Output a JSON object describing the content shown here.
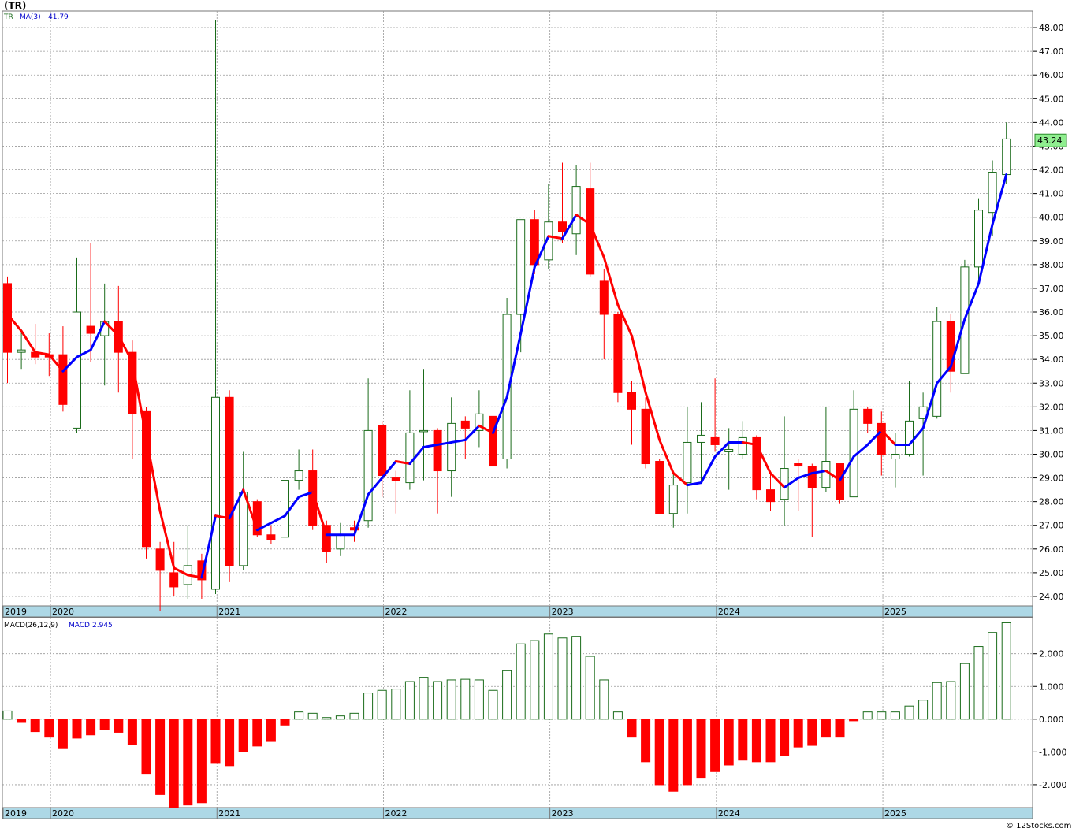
{
  "header": {
    "symbol": "(TR)"
  },
  "watermark": "© 12Stocks.com",
  "colors": {
    "up": "#1a6b1a",
    "down": "#ff0000",
    "ma_up": "#0000ff",
    "ma_down": "#ff0000",
    "axis_bar": "#add8e6",
    "last_box": "#90ee90"
  },
  "chart_data": [
    {
      "type": "candlestick",
      "legend": {
        "symbol": "TR",
        "ma_label": "MA(3)",
        "ma_value": "41.79"
      },
      "last_price_label": "43.24",
      "ylim": [
        23.6,
        48.7
      ],
      "y_ticks": [
        "24.00",
        "25.00",
        "26.00",
        "27.00",
        "28.00",
        "29.00",
        "30.00",
        "31.00",
        "32.00",
        "33.00",
        "34.00",
        "35.00",
        "36.00",
        "37.00",
        "38.00",
        "39.00",
        "40.00",
        "41.00",
        "42.00",
        "43.00",
        "44.00",
        "45.00",
        "46.00",
        "47.00",
        "48.00"
      ],
      "x_ticks": [
        {
          "label": "2019",
          "index": -0.4
        },
        {
          "label": "2020",
          "index": 3.1
        },
        {
          "label": "2021",
          "index": 15.1
        },
        {
          "label": "2022",
          "index": 27.1
        },
        {
          "label": "2023",
          "index": 39.1
        },
        {
          "label": "2024",
          "index": 51.1
        },
        {
          "label": "2025",
          "index": 63.1
        }
      ],
      "candles": [
        {
          "o": 37.2,
          "h": 37.5,
          "l": 33.0,
          "c": 34.3
        },
        {
          "o": 34.3,
          "h": 35.3,
          "l": 33.6,
          "c": 34.4
        },
        {
          "o": 34.3,
          "h": 35.5,
          "l": 33.8,
          "c": 34.1
        },
        {
          "o": 34.2,
          "h": 35.1,
          "l": 33.3,
          "c": 34.1
        },
        {
          "o": 34.2,
          "h": 35.4,
          "l": 31.8,
          "c": 32.1
        },
        {
          "o": 31.1,
          "h": 38.3,
          "l": 30.9,
          "c": 36.0
        },
        {
          "o": 35.4,
          "h": 38.9,
          "l": 33.9,
          "c": 35.1
        },
        {
          "o": 35.0,
          "h": 37.2,
          "l": 32.9,
          "c": 35.6
        },
        {
          "o": 35.6,
          "h": 37.1,
          "l": 32.6,
          "c": 34.3
        },
        {
          "o": 34.3,
          "h": 34.8,
          "l": 29.8,
          "c": 31.7
        },
        {
          "o": 31.8,
          "h": 32.0,
          "l": 25.6,
          "c": 26.1
        },
        {
          "o": 26.0,
          "h": 26.3,
          "l": 23.4,
          "c": 25.1
        },
        {
          "o": 25.0,
          "h": 26.3,
          "l": 24.0,
          "c": 24.4
        },
        {
          "o": 24.5,
          "h": 27.0,
          "l": 23.9,
          "c": 25.3
        },
        {
          "o": 25.5,
          "h": 25.8,
          "l": 23.9,
          "c": 24.7
        },
        {
          "o": 24.3,
          "h": 48.3,
          "l": 24.1,
          "c": 32.4
        },
        {
          "o": 32.4,
          "h": 32.7,
          "l": 24.6,
          "c": 25.3
        },
        {
          "o": 25.3,
          "h": 30.1,
          "l": 25.1,
          "c": 28.4
        },
        {
          "o": 28.0,
          "h": 28.1,
          "l": 26.5,
          "c": 26.6
        },
        {
          "o": 26.6,
          "h": 27.0,
          "l": 26.2,
          "c": 26.4
        },
        {
          "o": 26.5,
          "h": 30.9,
          "l": 26.4,
          "c": 28.9
        },
        {
          "o": 28.9,
          "h": 30.2,
          "l": 28.5,
          "c": 29.3
        },
        {
          "o": 29.3,
          "h": 30.2,
          "l": 26.8,
          "c": 27.0
        },
        {
          "o": 27.0,
          "h": 27.2,
          "l": 25.4,
          "c": 25.9
        },
        {
          "o": 26.0,
          "h": 27.1,
          "l": 25.7,
          "c": 26.6
        },
        {
          "o": 26.9,
          "h": 27.2,
          "l": 26.3,
          "c": 26.8
        },
        {
          "o": 27.2,
          "h": 33.2,
          "l": 26.9,
          "c": 31.0
        },
        {
          "o": 31.2,
          "h": 31.4,
          "l": 28.2,
          "c": 29.1
        },
        {
          "o": 29.0,
          "h": 29.3,
          "l": 27.5,
          "c": 28.9
        },
        {
          "o": 28.8,
          "h": 32.7,
          "l": 28.5,
          "c": 30.9
        },
        {
          "o": 31.0,
          "h": 33.6,
          "l": 28.9,
          "c": 31.0
        },
        {
          "o": 31.0,
          "h": 31.1,
          "l": 27.5,
          "c": 29.3
        },
        {
          "o": 29.3,
          "h": 32.4,
          "l": 28.2,
          "c": 31.3
        },
        {
          "o": 31.4,
          "h": 31.6,
          "l": 29.8,
          "c": 31.1
        },
        {
          "o": 31.0,
          "h": 32.7,
          "l": 30.3,
          "c": 31.7
        },
        {
          "o": 31.6,
          "h": 31.8,
          "l": 29.4,
          "c": 29.5
        },
        {
          "o": 29.8,
          "h": 36.6,
          "l": 29.4,
          "c": 35.9
        },
        {
          "o": 35.9,
          "h": 39.9,
          "l": 34.3,
          "c": 39.9
        },
        {
          "o": 39.9,
          "h": 40.3,
          "l": 37.6,
          "c": 38.0
        },
        {
          "o": 38.2,
          "h": 41.4,
          "l": 37.8,
          "c": 39.8
        },
        {
          "o": 39.8,
          "h": 42.3,
          "l": 38.9,
          "c": 39.4
        },
        {
          "o": 39.3,
          "h": 42.2,
          "l": 38.4,
          "c": 41.3
        },
        {
          "o": 41.2,
          "h": 42.3,
          "l": 37.5,
          "c": 37.6
        },
        {
          "o": 37.3,
          "h": 37.8,
          "l": 34.0,
          "c": 35.9
        },
        {
          "o": 35.9,
          "h": 36.0,
          "l": 32.2,
          "c": 32.6
        },
        {
          "o": 32.6,
          "h": 33.1,
          "l": 30.4,
          "c": 31.9
        },
        {
          "o": 31.9,
          "h": 32.4,
          "l": 29.4,
          "c": 29.6
        },
        {
          "o": 29.7,
          "h": 29.8,
          "l": 27.6,
          "c": 27.5
        },
        {
          "o": 27.5,
          "h": 29.2,
          "l": 26.9,
          "c": 28.7
        },
        {
          "o": 28.8,
          "h": 32.0,
          "l": 27.5,
          "c": 30.5
        },
        {
          "o": 30.5,
          "h": 32.2,
          "l": 28.8,
          "c": 30.8
        },
        {
          "o": 30.7,
          "h": 33.2,
          "l": 30.1,
          "c": 30.4
        },
        {
          "o": 30.1,
          "h": 31.1,
          "l": 28.5,
          "c": 30.2
        },
        {
          "o": 30.0,
          "h": 31.4,
          "l": 29.8,
          "c": 30.7
        },
        {
          "o": 30.7,
          "h": 30.8,
          "l": 28.1,
          "c": 28.5
        },
        {
          "o": 28.5,
          "h": 29.2,
          "l": 27.6,
          "c": 28.0
        },
        {
          "o": 28.1,
          "h": 31.6,
          "l": 27.0,
          "c": 29.4
        },
        {
          "o": 29.6,
          "h": 29.8,
          "l": 27.6,
          "c": 29.5
        },
        {
          "o": 29.5,
          "h": 29.6,
          "l": 26.5,
          "c": 28.6
        },
        {
          "o": 28.6,
          "h": 32.0,
          "l": 28.4,
          "c": 29.7
        },
        {
          "o": 29.6,
          "h": 29.6,
          "l": 27.9,
          "c": 28.1
        },
        {
          "o": 28.2,
          "h": 32.7,
          "l": 28.2,
          "c": 31.9
        },
        {
          "o": 31.9,
          "h": 32.0,
          "l": 30.9,
          "c": 31.3
        },
        {
          "o": 31.3,
          "h": 31.8,
          "l": 29.1,
          "c": 30.0
        },
        {
          "o": 29.8,
          "h": 30.9,
          "l": 28.6,
          "c": 30.0
        },
        {
          "o": 30.0,
          "h": 33.1,
          "l": 29.9,
          "c": 31.4
        },
        {
          "o": 31.5,
          "h": 32.6,
          "l": 29.1,
          "c": 32.0
        },
        {
          "o": 31.6,
          "h": 36.2,
          "l": 31.5,
          "c": 35.6
        },
        {
          "o": 35.6,
          "h": 35.9,
          "l": 32.6,
          "c": 33.5
        },
        {
          "o": 33.4,
          "h": 38.2,
          "l": 33.4,
          "c": 37.9
        },
        {
          "o": 37.9,
          "h": 40.8,
          "l": 37.2,
          "c": 40.3
        },
        {
          "o": 40.2,
          "h": 42.4,
          "l": 39.2,
          "c": 41.9
        },
        {
          "o": 41.8,
          "h": 44.0,
          "l": 41.4,
          "c": 43.3
        }
      ],
      "ma3": [
        35.9,
        35.2,
        34.3,
        34.2,
        33.5,
        34.1,
        34.4,
        35.6,
        35.0,
        33.9,
        30.7,
        27.6,
        25.2,
        24.9,
        24.8,
        27.4,
        27.3,
        28.5,
        26.8,
        27.1,
        27.4,
        28.2,
        28.4,
        26.6,
        26.6,
        26.6,
        28.3,
        29.0,
        29.7,
        29.6,
        30.3,
        30.4,
        30.5,
        30.6,
        31.2,
        30.9,
        32.4,
        35.1,
        37.9,
        39.2,
        39.1,
        40.1,
        39.7,
        38.3,
        36.3,
        35.0,
        32.6,
        30.6,
        29.2,
        28.7,
        28.8,
        29.9,
        30.5,
        30.5,
        30.4,
        29.2,
        28.6,
        29.0,
        29.2,
        29.3,
        28.9,
        29.9,
        30.4,
        31.0,
        30.4,
        30.4,
        31.1,
        33.0,
        33.7,
        35.7,
        37.2,
        39.7,
        41.8
      ],
      "ma3_down_from": [
        0,
        3,
        7,
        17,
        21,
        30,
        42,
        47,
        53,
        56,
        61
      ],
      "ma3_up_from": [
        2,
        6,
        14,
        19,
        28,
        34,
        50,
        52,
        58,
        63
      ]
    },
    {
      "type": "bar",
      "legend": {
        "label": "MACD(26,12,9)",
        "value_label": "MACD:2.945"
      },
      "ylim": [
        -2.7,
        3.1
      ],
      "y_ticks": [
        "-2.000",
        "-1.000",
        "0.000",
        "1.000",
        "2.000"
      ],
      "values": [
        0.25,
        -0.1,
        -0.38,
        -0.55,
        -0.9,
        -0.58,
        -0.48,
        -0.32,
        -0.4,
        -0.78,
        -1.68,
        -2.3,
        -2.7,
        -2.62,
        -2.55,
        -1.35,
        -1.42,
        -0.98,
        -0.82,
        -0.68,
        -0.18,
        0.22,
        0.18,
        0.05,
        0.1,
        0.18,
        0.8,
        0.88,
        0.92,
        1.15,
        1.28,
        1.15,
        1.2,
        1.22,
        1.2,
        0.88,
        1.48,
        2.3,
        2.4,
        2.6,
        2.48,
        2.53,
        1.92,
        1.2,
        0.22,
        -0.55,
        -1.3,
        -2.0,
        -2.2,
        -2.0,
        -1.8,
        -1.6,
        -1.4,
        -1.25,
        -1.3,
        -1.3,
        -1.1,
        -0.85,
        -0.8,
        -0.55,
        -0.55,
        -0.05,
        0.22,
        0.22,
        0.22,
        0.4,
        0.58,
        1.12,
        1.15,
        1.7,
        2.22,
        2.65,
        2.945
      ],
      "colors_down": [
        1,
        2,
        3,
        4,
        5,
        6,
        7,
        8,
        9,
        10,
        11,
        12,
        13,
        14,
        15,
        16,
        17,
        18,
        19,
        20,
        45,
        46,
        47,
        48,
        49,
        50,
        51,
        52,
        53,
        54,
        55,
        56,
        57,
        58,
        59,
        60,
        61
      ]
    }
  ]
}
